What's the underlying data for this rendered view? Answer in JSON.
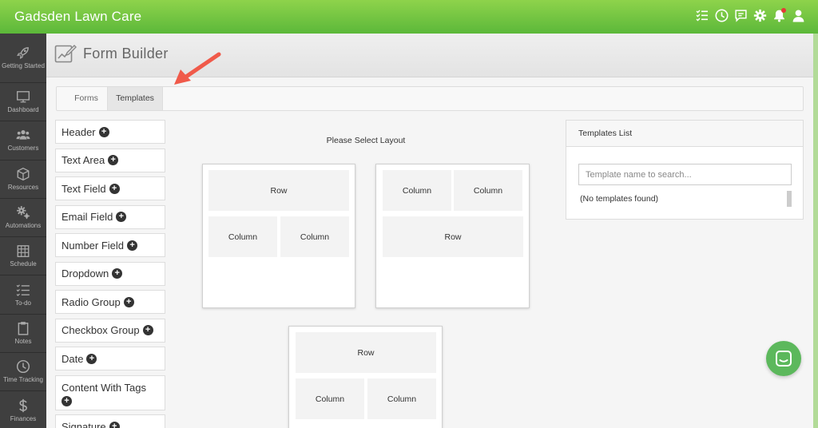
{
  "app": {
    "title": "Gadsden Lawn Care"
  },
  "topbar_icons": [
    "checklist-icon",
    "clock-icon",
    "chat-icon",
    "gear-icon",
    "bell-icon",
    "user-icon"
  ],
  "sidebar": {
    "items": [
      {
        "label": "Getting Started",
        "icon": "rocket-icon"
      },
      {
        "label": "Dashboard",
        "icon": "monitor-icon"
      },
      {
        "label": "Customers",
        "icon": "users-icon"
      },
      {
        "label": "Resources",
        "icon": "cube-icon"
      },
      {
        "label": "Automations",
        "icon": "gears-icon"
      },
      {
        "label": "Schedule",
        "icon": "calendar-icon"
      },
      {
        "label": "To-do",
        "icon": "list-check-icon"
      },
      {
        "label": "Notes",
        "icon": "clipboard-icon"
      },
      {
        "label": "Time Tracking",
        "icon": "clock-icon"
      },
      {
        "label": "Finances",
        "icon": "dollar-icon"
      }
    ]
  },
  "page": {
    "title": "Form Builder"
  },
  "tabs": [
    {
      "label": "Forms",
      "active": false
    },
    {
      "label": "Templates",
      "active": true
    }
  ],
  "fields": [
    {
      "label": "Header"
    },
    {
      "label": "Text Area"
    },
    {
      "label": "Text Field"
    },
    {
      "label": "Email Field"
    },
    {
      "label": "Number Field"
    },
    {
      "label": "Dropdown"
    },
    {
      "label": "Radio Group"
    },
    {
      "label": "Checkbox Group"
    },
    {
      "label": "Date"
    },
    {
      "label": "Content With Tags"
    },
    {
      "label": "Signature"
    }
  ],
  "layouts": {
    "title": "Please Select Layout",
    "row": "Row",
    "column": "Column"
  },
  "templates_panel": {
    "title": "Templates List",
    "search_placeholder": "Template name to search...",
    "empty_text": "(No templates found)"
  },
  "colors": {
    "topbar": "#6cc644",
    "accent": "#5cb85c",
    "arrow": "#f05a4a",
    "sidebar": "#3f3f3f"
  }
}
